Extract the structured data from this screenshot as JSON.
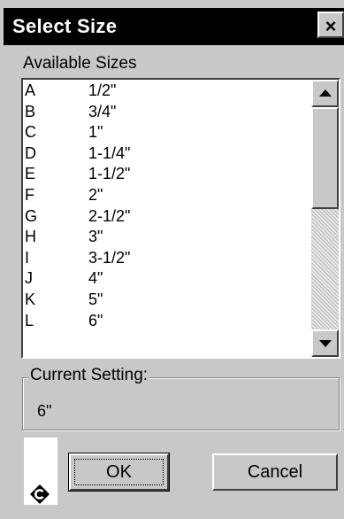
{
  "window": {
    "title": "Select Size",
    "close_label": "×"
  },
  "sizes_section": {
    "label": "Available Sizes",
    "items": [
      {
        "code": "A",
        "size": "1/2\""
      },
      {
        "code": "B",
        "size": "3/4\""
      },
      {
        "code": "C",
        "size": "1\""
      },
      {
        "code": "D",
        "size": "1-1/4\""
      },
      {
        "code": "E",
        "size": "1-1/2\""
      },
      {
        "code": "F",
        "size": "2\""
      },
      {
        "code": "G",
        "size": "2-1/2\""
      },
      {
        "code": "H",
        "size": "3\""
      },
      {
        "code": "I",
        "size": "3-1/2\""
      },
      {
        "code": "J",
        "size": "4\""
      },
      {
        "code": "K",
        "size": "5\""
      },
      {
        "code": "L",
        "size": "6\""
      }
    ]
  },
  "current_setting": {
    "label": "Current Setting:",
    "value": "6\""
  },
  "buttons": {
    "ok_label": "OK",
    "cancel_label": "Cancel"
  },
  "icons": {
    "scroll_up": "arrow-up-icon",
    "scroll_down": "arrow-down-icon",
    "logo": "c-logo-icon"
  }
}
